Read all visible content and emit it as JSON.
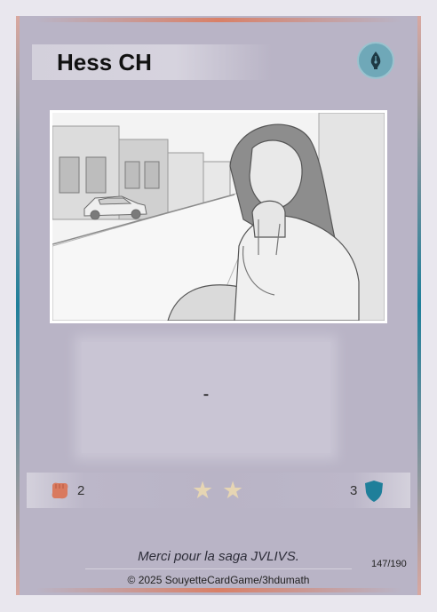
{
  "card": {
    "name": "Hess CH",
    "type_icon": "pen-nib-icon",
    "ability_text": "-",
    "stats": {
      "attack": "2",
      "attack_icon": "fist-icon",
      "stars": 2,
      "defense": "3",
      "defense_icon": "shield-icon"
    },
    "flavor_text": "Merci pour la saga JVLIVS.",
    "card_number": "147/190",
    "copyright": "© 2025 SouyetteCardGame/3hdumath"
  },
  "colors": {
    "frame": "#b9b4c6",
    "accent_teal": "#1f7f9a",
    "accent_coral": "#d98067",
    "attack_color": "#d97a5f",
    "defense_color": "#1f7f9a",
    "star_color": "#e6d5b3"
  }
}
